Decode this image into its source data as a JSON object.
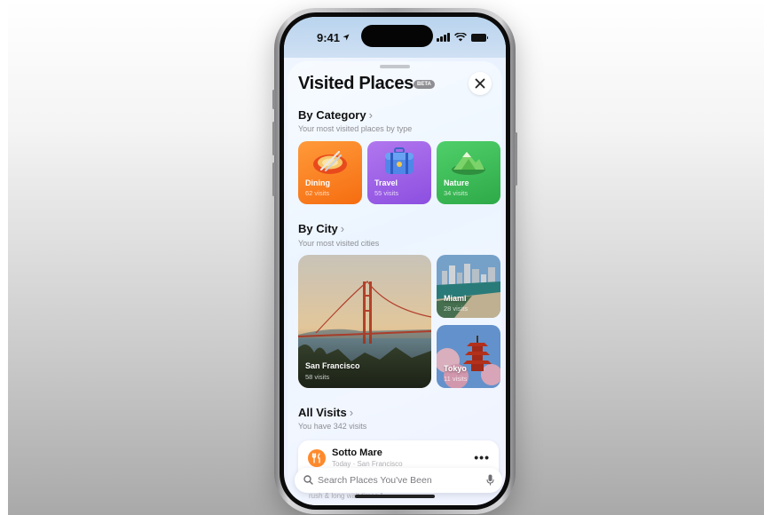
{
  "status_bar": {
    "time": "9:41"
  },
  "sheet": {
    "title": "Visited Places",
    "badge": "BETA"
  },
  "categories": {
    "heading": "By Category",
    "subtitle": "Your most visited places by type",
    "items": [
      {
        "label": "Dining",
        "count": "62 visits",
        "icon": "plate-icon",
        "color": "#f57a1e"
      },
      {
        "label": "Travel",
        "count": "55 visits",
        "icon": "suitcase-icon",
        "color": "#9a5ee6"
      },
      {
        "label": "Nature",
        "count": "34 visits",
        "icon": "mountain-icon",
        "color": "#3cbd58"
      }
    ]
  },
  "cities": {
    "heading": "By City",
    "subtitle": "Your most visited cities",
    "items": [
      {
        "name": "San Francisco",
        "count": "58 visits"
      },
      {
        "name": "Miami",
        "count": "28 visits"
      },
      {
        "name": "Tokyo",
        "count": "11 visits"
      }
    ]
  },
  "all_visits": {
    "heading": "All Visits",
    "subtitle": "You have 342 visits",
    "items": [
      {
        "name": "Sotto Mare",
        "meta": "Today · San Francisco",
        "snippet": "rush & long wait times.\""
      }
    ]
  },
  "search": {
    "placeholder": "Search Places You've Been"
  }
}
